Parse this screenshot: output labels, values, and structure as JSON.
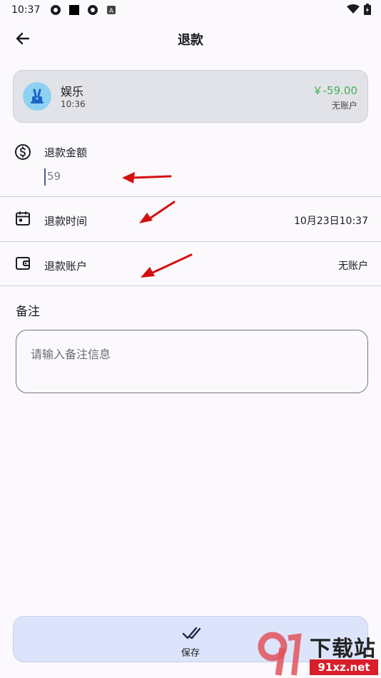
{
  "status_bar": {
    "time": "10:37"
  },
  "header": {
    "title": "退款",
    "back_icon": "arrow-left-icon"
  },
  "record": {
    "category": "娱乐",
    "time": "10:36",
    "amount": "￥-59.00",
    "account": "无账户",
    "avatar_icon": "magic-hat-icon",
    "amount_color": "#45ad5a"
  },
  "refund_amount": {
    "label": "退款金额",
    "value": "59",
    "icon": "dollar-circle-icon"
  },
  "refund_time": {
    "label": "退款时间",
    "value": "10月23日10:37",
    "icon": "calendar-icon"
  },
  "refund_account": {
    "label": "退款账户",
    "value": "无账户",
    "icon": "wallet-icon"
  },
  "note": {
    "label": "备注",
    "placeholder": "请输入备注信息"
  },
  "save": {
    "label": "保存",
    "icon": "double-check-icon"
  },
  "watermark": {
    "text": "下载站",
    "url": "91xz.net"
  },
  "colors": {
    "annotation_arrow": "#d40f0f",
    "accent": "#dbe4fb"
  }
}
